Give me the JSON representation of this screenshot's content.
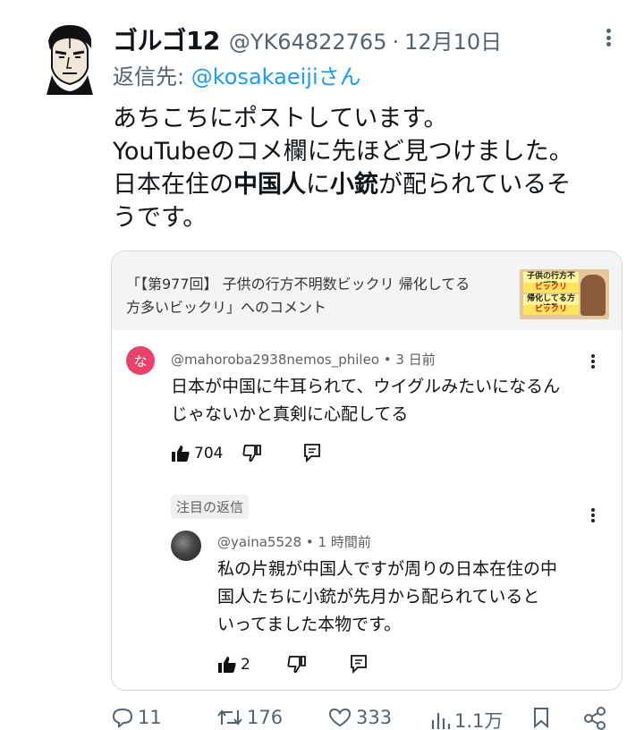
{
  "tweet": {
    "author_name": "ゴルゴ12",
    "handle": "@YK64822765",
    "separator": "·",
    "date": "12月10日",
    "reply_prefix": "返信先: ",
    "reply_handle": "@kosakaeiji",
    "reply_suffix": "さん",
    "text": {
      "line1": "あちこちにポストしています。",
      "line2": "YouTubeのコメ欄に先ほど見つけました。",
      "line3_a": "日本在住の",
      "line3_b": "中国人",
      "line3_c": "に",
      "line3_d": "小銃",
      "line3_e": "が配られているそ",
      "line4": "うです。"
    }
  },
  "card": {
    "title_line1": "「【第977回】 子供の行方不明数ビックリ 帰化してる",
    "title_line2": "方多いビックリ」へのコメント",
    "thumbnail": {
      "line1": "子供の行方不明数",
      "line2": "ビックリ",
      "line3": "帰化してる方達数",
      "line4": "ビックリ"
    },
    "comment": {
      "avatar_letter": "な",
      "author": "@mahoroba2938nemos_phileo",
      "time": "• 3 日前",
      "text_line1": "日本が中国に牛耳られて、ウイグルみたいになるん",
      "text_line2": "じゃないかと真剣に心配してる",
      "likes": "704"
    },
    "reply_chip": "注目の返信",
    "reply": {
      "author": "@yaina5528",
      "time": "• 1 時間前",
      "text_line1": "私の片親が中国人ですが周りの日本在住の中",
      "text_line2": "国人たちに小銃が先月から配られていると",
      "text_line3": "いってました本物です。",
      "likes": "2"
    }
  },
  "actions": {
    "replies": "11",
    "retweets": "176",
    "likes": "333",
    "views": "1.1万"
  }
}
